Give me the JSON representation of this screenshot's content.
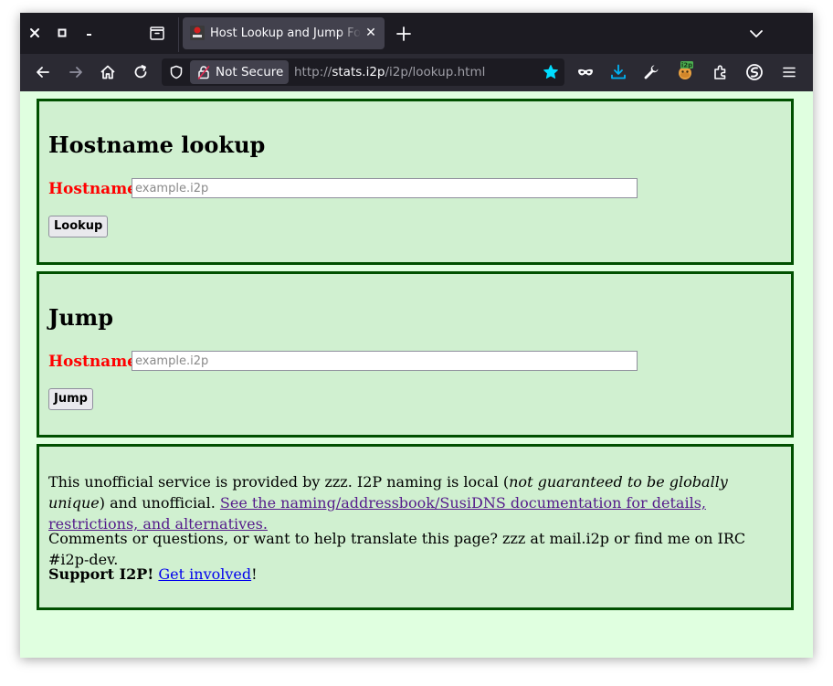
{
  "browser": {
    "window_controls": {
      "close": "✕",
      "maximize": "□",
      "minimize": "–"
    },
    "tab": {
      "title": "Host Lookup and Jump Form",
      "close_glyph": "✕"
    },
    "new_tab_glyph": "+",
    "urlbar": {
      "security_label": "Not Secure",
      "url_scheme": "http://",
      "url_host": "stats.i2p",
      "url_path": "/i2p/lookup.html"
    },
    "icons": [
      "close-icon",
      "maximize-icon",
      "minimize-icon",
      "tab-list-icon",
      "plus-icon",
      "chevron-down-icon",
      "back-arrow-icon",
      "forward-arrow-icon",
      "home-icon",
      "reload-icon",
      "shield-icon",
      "insecure-lock-icon",
      "bookmark-star-icon",
      "private-mask-icon",
      "downloads-icon",
      "wrench-icon",
      "i2p-extension-icon",
      "extensions-puzzle-icon",
      "account-icon",
      "hamburger-menu-icon"
    ],
    "colors": {
      "tabbar_bg": "#1c1b22",
      "navbar_bg": "#2b2a33",
      "star_accent": "#00ddff",
      "download_accent": "#00b3f4"
    }
  },
  "page": {
    "colors": {
      "background": "#e0ffe0",
      "box_background": "#d0f0d0",
      "box_border": "#005000",
      "label_red": "#ff0000"
    },
    "lookup": {
      "heading": "Hostname lookup",
      "field_label": "Hostname",
      "colon": ":",
      "placeholder": "example.i2p",
      "value": "",
      "button": "Lookup"
    },
    "jump": {
      "heading": "Jump",
      "field_label": "Hostname",
      "colon": ":",
      "placeholder": "example.i2p",
      "value": "",
      "button": "Jump"
    },
    "info": {
      "p1_prefix": "This unofficial service is provided by zzz. I2P naming is local (",
      "p1_em": "not guaranteed to be globally unique",
      "p1_mid": ") and unofficial. ",
      "p1_link": "See the naming/addressbook/SusiDNS documentation for details, restrictions, and alternatives.",
      "p2": "Comments or questions, or want to help translate this page? zzz at mail.i2p or find me on IRC #i2p-dev.",
      "p3_strong": "Support I2P!",
      "p3_space": " ",
      "p3_link": "Get involved",
      "p3_suffix": "!"
    }
  }
}
